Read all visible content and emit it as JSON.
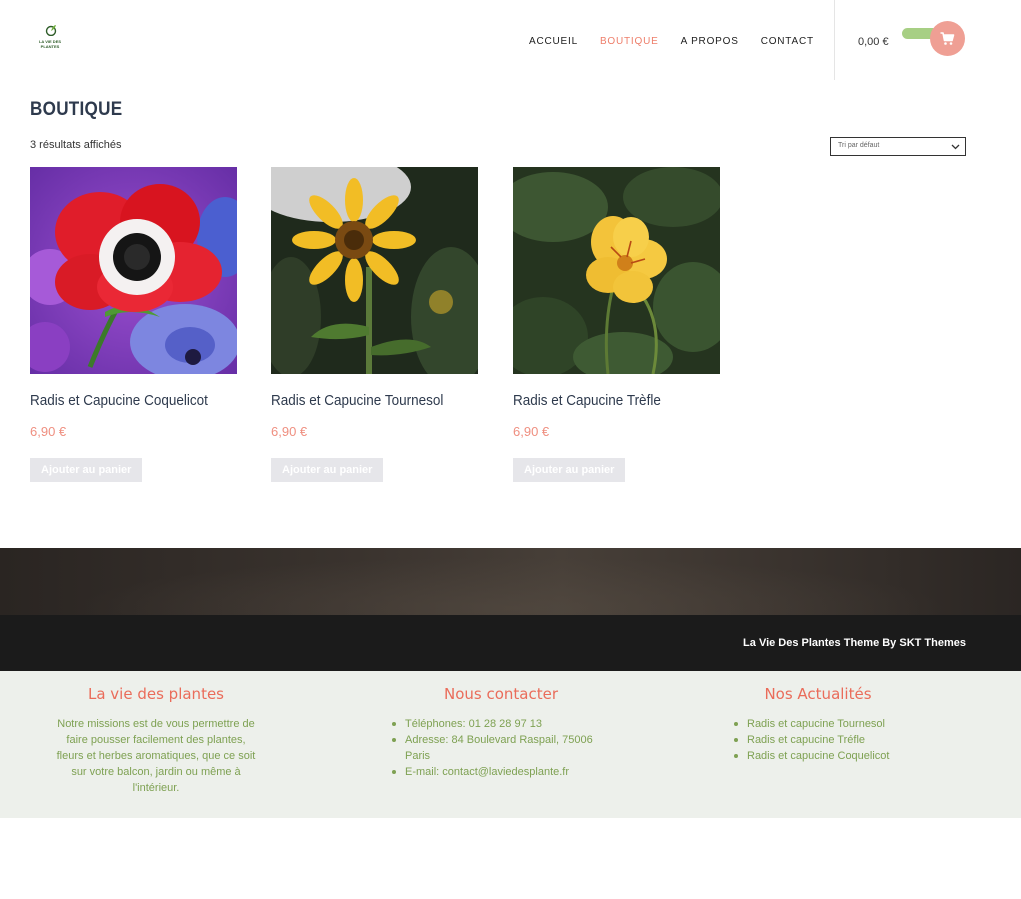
{
  "header": {
    "logo_text": "LA VIE DES PLANTES",
    "nav": [
      {
        "label": "ACCUEIL",
        "active": false
      },
      {
        "label": "BOUTIQUE",
        "active": true
      },
      {
        "label": "A PROPOS",
        "active": false
      },
      {
        "label": "CONTACT",
        "active": false
      }
    ],
    "cart_total": "0,00 €",
    "cart_icon": "shopping-cart-icon"
  },
  "main": {
    "title": "BOUTIQUE",
    "results_text": "3 résultats affichés",
    "sort": {
      "selected": "Tri par défaut"
    },
    "products": [
      {
        "name": "Radis et Capucine Coquelicot",
        "price": "6,90 €",
        "button": "Ajouter au panier",
        "image": "red-anemone-flower"
      },
      {
        "name": "Radis et Capucine Tournesol",
        "price": "6,90 €",
        "button": "Ajouter au panier",
        "image": "sunflower"
      },
      {
        "name": "Radis et Capucine Trèfle",
        "price": "6,90 €",
        "button": "Ajouter au panier",
        "image": "yellow-nasturtium"
      }
    ]
  },
  "credit": "La Vie Des Plantes Theme By SKT Themes",
  "footer": {
    "about": {
      "title": "La vie des plantes",
      "lines": [
        "Notre missions est de vous permettre de",
        "faire pousser facilement des plantes,",
        "fleurs et herbes aromatiques, que ce soit",
        "sur votre balcon, jardin ou même à",
        "l'intérieur."
      ]
    },
    "contact": {
      "title": "Nous contacter",
      "items": [
        {
          "lines": [
            "Téléphones: 01 28 28 97 13"
          ]
        },
        {
          "lines": [
            "Adresse: 84 Boulevard Raspail, 75006",
            "Paris"
          ]
        },
        {
          "lines": [
            "E-mail: contact@laviedesplante.fr"
          ]
        }
      ]
    },
    "news": {
      "title": "Nos Actualités",
      "items": [
        "Radis et capucine Tournesol",
        "Radis et capucine Tréfle",
        "Radis et capucine Coquelicot"
      ]
    }
  },
  "colors": {
    "accent": "#ee7e6a",
    "cart_button": "#ef9f94",
    "cart_pill": "#a7cf84",
    "footer_bg": "#edf0eb",
    "footer_text": "#7ea152",
    "footer_heading": "#ea6c5a"
  }
}
